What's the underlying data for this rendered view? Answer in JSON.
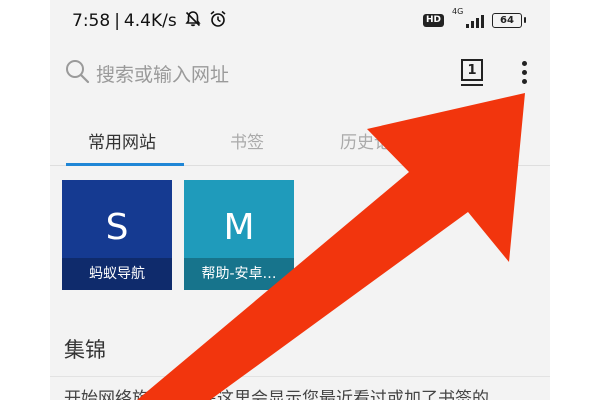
{
  "status_bar": {
    "time": "7:58",
    "separator": "|",
    "network_speed": "4.4K/s",
    "icons": [
      "mute-icon",
      "alarm-icon"
    ],
    "hd_label": "HD",
    "network_type": "4G",
    "battery_level": "64"
  },
  "search": {
    "placeholder": "搜索或输入网址",
    "tab_count": "1"
  },
  "tabs": [
    {
      "label": "常用网站",
      "active": true
    },
    {
      "label": "书签",
      "active": false
    },
    {
      "label": "历史记录",
      "active": false
    }
  ],
  "tiles": [
    {
      "letter": "S",
      "label": "蚂蚁导航",
      "color": "#153a91"
    },
    {
      "letter": "M",
      "label": "帮助-安卓…",
      "color": "#1f9bbb"
    }
  ],
  "section": {
    "title": "集锦"
  },
  "bottom_text": "开始网络旅程吧，在这里会显示您最近看过或加了书签的",
  "colors": {
    "accent": "#1f86d6",
    "arrow": "#f2350d",
    "background": "#f3f3f3"
  }
}
